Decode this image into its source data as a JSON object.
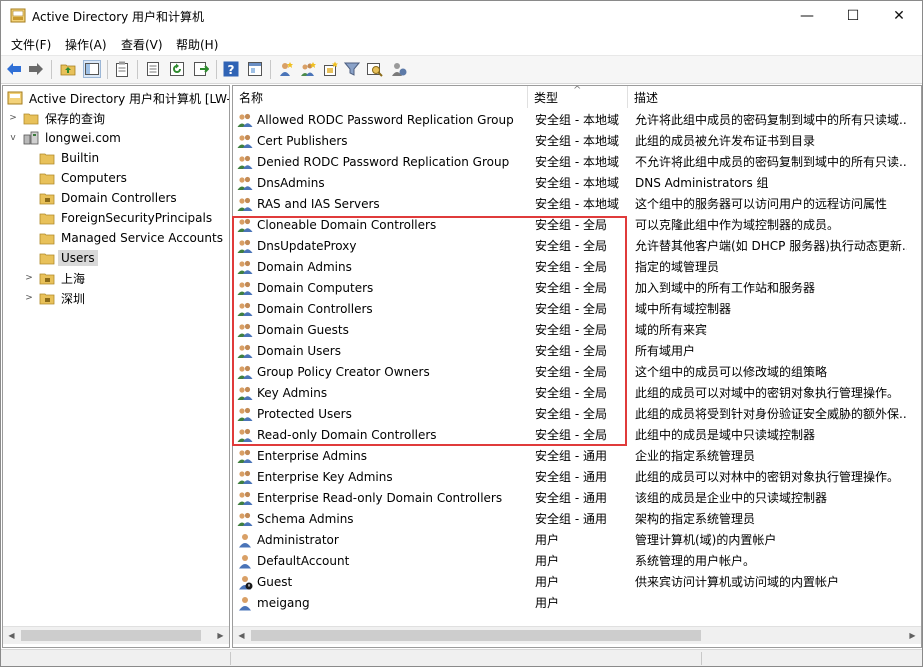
{
  "window": {
    "title": "Active Directory 用户和计算机",
    "controls": {
      "minimize": "—",
      "maximize": "☐",
      "close": "✕"
    }
  },
  "menu": [
    "文件(F)",
    "操作(A)",
    "查看(V)",
    "帮助(H)"
  ],
  "tree": {
    "root": "Active Directory 用户和计算机 [LW-",
    "saved_queries": "保存的查询",
    "domain": "longwei.com",
    "children": [
      "Builtin",
      "Computers",
      "Domain Controllers",
      "ForeignSecurityPrincipals",
      "Managed Service Accounts",
      "Users",
      "上海",
      "深圳"
    ]
  },
  "list": {
    "columns": {
      "name": "名称",
      "type": "类型",
      "description": "描述"
    },
    "sort_indicator": "^",
    "rows": [
      {
        "name": "Allowed RODC Password Replication Group",
        "type": "安全组 - 本地域",
        "desc": "允许将此组中成员的密码复制到域中的所有只读域...",
        "icon": "group-icon"
      },
      {
        "name": "Cert Publishers",
        "type": "安全组 - 本地域",
        "desc": "此组的成员被允许发布证书到目录",
        "icon": "group-icon"
      },
      {
        "name": "Denied RODC Password Replication Group",
        "type": "安全组 - 本地域",
        "desc": "不允许将此组中成员的密码复制到域中的所有只读...",
        "icon": "group-icon"
      },
      {
        "name": "DnsAdmins",
        "type": "安全组 - 本地域",
        "desc": "DNS Administrators 组",
        "icon": "group-icon"
      },
      {
        "name": "RAS and IAS Servers",
        "type": "安全组 - 本地域",
        "desc": "这个组中的服务器可以访问用户的远程访问属性",
        "icon": "group-icon"
      },
      {
        "name": "Cloneable Domain Controllers",
        "type": "安全组 - 全局",
        "desc": "可以克隆此组中作为域控制器的成员。",
        "icon": "group-icon"
      },
      {
        "name": "DnsUpdateProxy",
        "type": "安全组 - 全局",
        "desc": "允许替其他客户端(如 DHCP 服务器)执行动态更新...",
        "icon": "group-icon"
      },
      {
        "name": "Domain Admins",
        "type": "安全组 - 全局",
        "desc": "指定的域管理员",
        "icon": "group-icon"
      },
      {
        "name": "Domain Computers",
        "type": "安全组 - 全局",
        "desc": "加入到域中的所有工作站和服务器",
        "icon": "group-icon"
      },
      {
        "name": "Domain Controllers",
        "type": "安全组 - 全局",
        "desc": "域中所有域控制器",
        "icon": "group-icon"
      },
      {
        "name": "Domain Guests",
        "type": "安全组 - 全局",
        "desc": "域的所有来宾",
        "icon": "group-icon"
      },
      {
        "name": "Domain Users",
        "type": "安全组 - 全局",
        "desc": "所有域用户",
        "icon": "group-icon"
      },
      {
        "name": "Group Policy Creator Owners",
        "type": "安全组 - 全局",
        "desc": "这个组中的成员可以修改域的组策略",
        "icon": "group-icon"
      },
      {
        "name": "Key Admins",
        "type": "安全组 - 全局",
        "desc": "此组的成员可以对域中的密钥对象执行管理操作。",
        "icon": "group-icon"
      },
      {
        "name": "Protected Users",
        "type": "安全组 - 全局",
        "desc": "此组的成员将受到针对身份验证安全威胁的额外保...",
        "icon": "group-icon"
      },
      {
        "name": "Read-only Domain Controllers",
        "type": "安全组 - 全局",
        "desc": "此组中的成员是域中只读域控制器",
        "icon": "group-icon"
      },
      {
        "name": "Enterprise Admins",
        "type": "安全组 - 通用",
        "desc": "企业的指定系统管理员",
        "icon": "group-icon"
      },
      {
        "name": "Enterprise Key Admins",
        "type": "安全组 - 通用",
        "desc": "此组的成员可以对林中的密钥对象执行管理操作。",
        "icon": "group-icon"
      },
      {
        "name": "Enterprise Read-only Domain Controllers",
        "type": "安全组 - 通用",
        "desc": "该组的成员是企业中的只读域控制器",
        "icon": "group-icon"
      },
      {
        "name": "Schema Admins",
        "type": "安全组 - 通用",
        "desc": "架构的指定系统管理员",
        "icon": "group-icon"
      },
      {
        "name": "Administrator",
        "type": "用户",
        "desc": "管理计算机(域)的内置帐户",
        "icon": "user-icon"
      },
      {
        "name": "DefaultAccount",
        "type": "用户",
        "desc": "系统管理的用户帐户。",
        "icon": "user-icon"
      },
      {
        "name": "Guest",
        "type": "用户",
        "desc": "供来宾访问计算机或访问域的内置帐户",
        "icon": "user-disabled-icon"
      },
      {
        "name": "meigang",
        "type": "用户",
        "desc": "",
        "icon": "user-icon"
      }
    ]
  },
  "colors": {
    "highlight_border": "#e03b3b",
    "selection": "#d9d9d9",
    "folder": "#e8c15a"
  }
}
